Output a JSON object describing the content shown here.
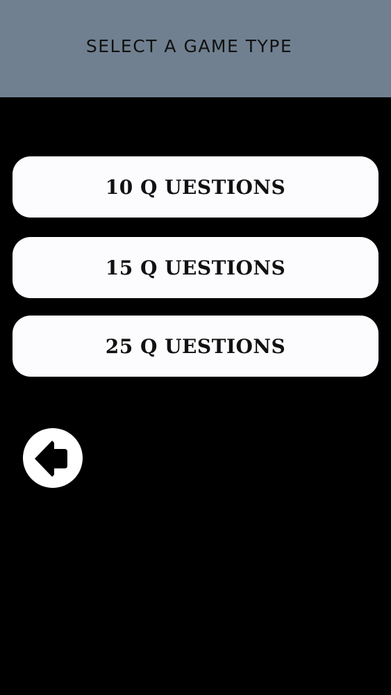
{
  "header": {
    "title": "SELECT A GAME TYPE"
  },
  "options": [
    {
      "label": "10 Q UESTIONS"
    },
    {
      "label": "15 Q UESTIONS"
    },
    {
      "label": "25 Q UESTIONS"
    }
  ],
  "back_button": {
    "icon": "arrow-left-icon"
  },
  "colors": {
    "header_background": "#708090",
    "page_background": "#000000",
    "button_background": "#fcfcfe",
    "text": "#111111"
  }
}
